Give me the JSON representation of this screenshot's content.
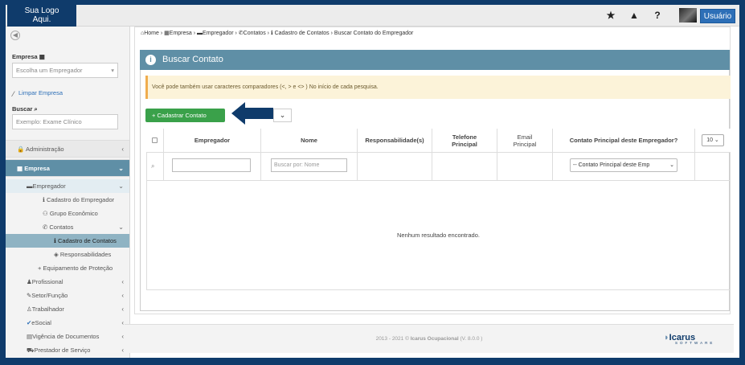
{
  "topbar": {
    "logo_text": "Sua Logo\nAqui.",
    "icons": [
      "star-icon",
      "warning-icon",
      "help-icon"
    ],
    "user_label": "Usuário"
  },
  "sidebar": {
    "empresa_label": "Empresa",
    "empresa_placeholder": "Escolha um Empregador",
    "limpar_label": "Limpar Empresa",
    "buscar_label": "Buscar",
    "buscar_placeholder": "Exemplo: Exame Clínico",
    "menu": [
      {
        "label": "Administração",
        "icon": "lock-icon"
      },
      {
        "label": "Empresa",
        "icon": "building-icon"
      },
      {
        "label": "Empregador",
        "icon": "briefcase-icon"
      },
      {
        "label": "Cadastro do Empregador",
        "icon": "info-icon"
      },
      {
        "label": "Grupo Econômico",
        "icon": "group-icon"
      },
      {
        "label": "Contatos",
        "icon": "phone-icon"
      },
      {
        "label": "Cadastro de Contatos",
        "icon": "info-icon"
      },
      {
        "label": "Responsabilidades",
        "icon": "diamond-icon"
      },
      {
        "label": "Equipamento de Proteção",
        "icon": "plus-icon"
      },
      {
        "label": "Profissional",
        "icon": "user-icon"
      },
      {
        "label": "Setor/Função",
        "icon": "wrench-icon"
      },
      {
        "label": "Trabalhador",
        "icon": "person-icon"
      },
      {
        "label": "eSocial",
        "icon": "check-icon"
      },
      {
        "label": "Vigência de Documentos",
        "icon": "calendar-icon"
      },
      {
        "label": "Prestador de Serviço",
        "icon": "car-icon"
      }
    ]
  },
  "breadcrumb": {
    "items": [
      "Home",
      "Empresa",
      "Empregador",
      "Contatos",
      "Cadastro de Contatos",
      "Buscar Contato do Empregador"
    ]
  },
  "panel": {
    "title": "Buscar Contato",
    "alert": "Você pode também usar caracteres comparadores (<, > e <> ) No início de cada pesquisa.",
    "add_button": "Cadastrar Contato"
  },
  "table": {
    "columns": [
      "Empregador",
      "Nome",
      "Responsabilidade(s)",
      "Telefone\nPrincipal",
      "Email\nPrincipal",
      "Contato Principal deste Empregador?"
    ],
    "page_size": "10",
    "filter_nome_placeholder": "Buscar por: Nome",
    "filter_contato_value": "-- Contato Principal deste Emp",
    "empty_message": "Nenhum resultado encontrado."
  },
  "footer": {
    "copyright_prefix": "2013 - 2021 © ",
    "company": "Icarus Ocupacional",
    "version": " (V. 8.0.0 )",
    "brand": "Icarus",
    "brand_sub": "SOFTWARE"
  },
  "colors": {
    "brand": "#0f3b6b",
    "panel_header": "#5f8fa6",
    "success": "#3aa14a",
    "primary": "#2d6fb7",
    "alert_bg": "#fcf3d9"
  }
}
